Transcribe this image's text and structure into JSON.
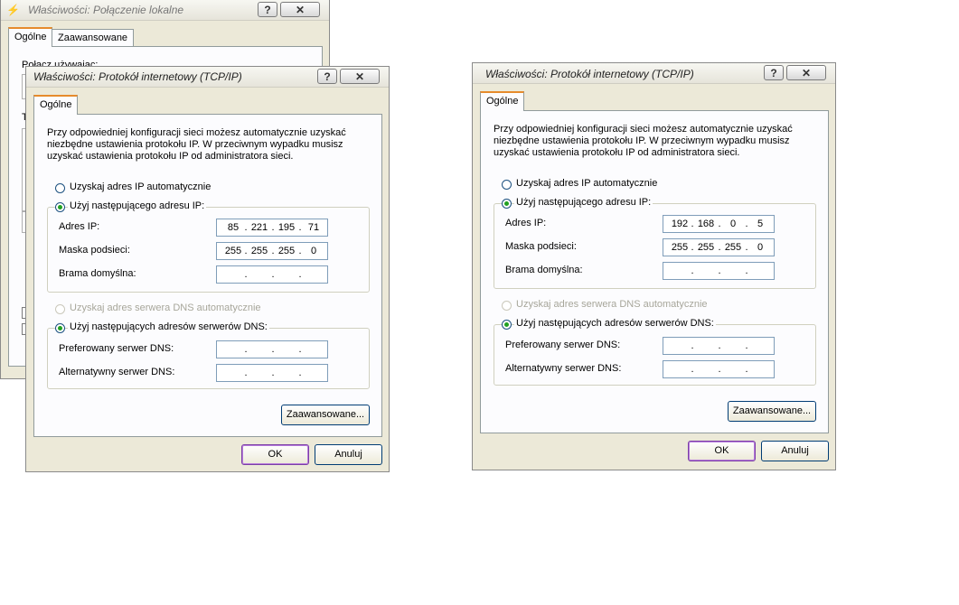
{
  "bg_window": {
    "title": "Właściwości: Połączenie lokalne",
    "tabs": [
      "Ogólne",
      "Zaawansowane"
    ],
    "connect_label": "Połącz używając:",
    "partial_label": "T"
  },
  "windows": [
    {
      "title": "Właściwości: Protokół internetowy (TCP/IP)",
      "tab": "Ogólne",
      "description": "Przy odpowiedniej konfiguracji sieci możesz automatycznie uzyskać\nniezbędne ustawienia protokołu IP. W przeciwnym wypadku musisz\nuzyskać ustawienia protokołu IP od administratora sieci.",
      "radio_auto_ip": "Uzyskaj adres IP automatycznie",
      "radio_manual_ip": "Użyj następującego adresu IP:",
      "ip_label": "Adres IP:",
      "ip_value": [
        "85",
        "221",
        "195",
        "71"
      ],
      "mask_label": "Maska podsieci:",
      "mask_value": [
        "255",
        "255",
        "255",
        "0"
      ],
      "gateway_label": "Brama domyślna:",
      "gateway_value": [
        "",
        "",
        "",
        ""
      ],
      "radio_auto_dns": "Uzyskaj adres serwera DNS automatycznie",
      "radio_manual_dns": "Użyj następujących adresów serwerów DNS:",
      "dns_pref_label": "Preferowany serwer DNS:",
      "dns_pref_value": [
        "",
        "",
        "",
        ""
      ],
      "dns_alt_label": "Alternatywny serwer DNS:",
      "dns_alt_value": [
        "",
        "",
        "",
        ""
      ],
      "advanced_button": "Zaawansowane...",
      "ok_button": "OK",
      "cancel_button": "Anuluj"
    },
    {
      "title": "Właściwości: Protokół internetowy (TCP/IP)",
      "tab": "Ogólne",
      "description": "Przy odpowiedniej konfiguracji sieci możesz automatycznie uzyskać\nniezbędne ustawienia protokołu IP. W przeciwnym wypadku musisz\nuzyskać ustawienia protokołu IP od administratora sieci.",
      "radio_auto_ip": "Uzyskaj adres IP automatycznie",
      "radio_manual_ip": "Użyj następującego adresu IP:",
      "ip_label": "Adres IP:",
      "ip_value": [
        "192",
        "168",
        "0",
        "5"
      ],
      "mask_label": "Maska podsieci:",
      "mask_value": [
        "255",
        "255",
        "255",
        "0"
      ],
      "gateway_label": "Brama domyślna:",
      "gateway_value": [
        "",
        "",
        "",
        ""
      ],
      "radio_auto_dns": "Uzyskaj adres serwera DNS automatycznie",
      "radio_manual_dns": "Użyj następujących adresów serwerów DNS:",
      "dns_pref_label": "Preferowany serwer DNS:",
      "dns_pref_value": [
        "",
        "",
        "",
        ""
      ],
      "dns_alt_label": "Alternatywny serwer DNS:",
      "dns_alt_value": [
        "",
        "",
        "",
        ""
      ],
      "advanced_button": "Zaawansowane...",
      "ok_button": "OK",
      "cancel_button": "Anuluj"
    }
  ],
  "title_buttons": {
    "help": "?",
    "close": "✕"
  }
}
